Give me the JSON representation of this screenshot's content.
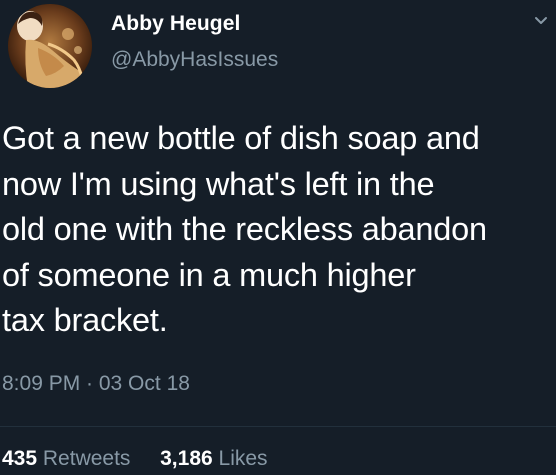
{
  "author": {
    "display_name": "Abby Heugel",
    "handle": "@AbbyHasIssues"
  },
  "tweet": {
    "text": "Got a new bottle of dish soap and\nnow I'm using what's left in the\nold one with the reckless abandon\nof someone in a much higher\ntax bracket.",
    "timestamp": "8:09 PM · 03 Oct 18"
  },
  "stats": {
    "retweets_count": "435",
    "retweets_label": "Retweets",
    "likes_count": "3,186",
    "likes_label": "Likes"
  },
  "icons": {
    "menu": "chevron-down-icon",
    "avatar": "avatar"
  },
  "colors": {
    "background": "#151e28",
    "text_primary": "#ffffff",
    "text_secondary": "#8899a6"
  }
}
